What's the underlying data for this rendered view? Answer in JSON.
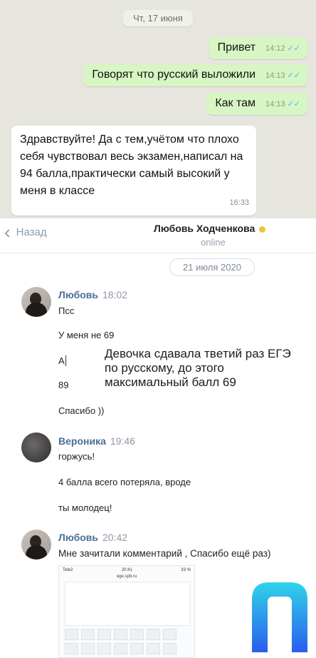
{
  "whatsapp": {
    "date_chip": "Чт, 17 июня",
    "outgoing": [
      {
        "text": "Привет",
        "time": "14:12",
        "ticks": "✓✓"
      },
      {
        "text": "Говорят что русский выложили",
        "time": "14:13",
        "ticks": "✓✓"
      },
      {
        "text": "Как там",
        "time": "14:13",
        "ticks": "✓✓"
      }
    ],
    "incoming": {
      "text": "Здравствуйте! Да с тем,учётом что плохо себя чувствовал весь экзамен,написал на 94 балла,практически самый высокий у меня в классе",
      "time": "16:33"
    }
  },
  "vk": {
    "back_label": "Назад",
    "contact_name": "Любовь Ходченкова",
    "contact_status": "online",
    "date_chip": "21 июля 2020",
    "messages": [
      {
        "sender": "Любовь",
        "time": "18:02",
        "lines": [
          "Псс",
          "У меня не 69",
          "А",
          "89",
          "Спасибо ))"
        ]
      },
      {
        "sender": "Вероника",
        "time": "19:46",
        "lines": [
          "горжусь!",
          "4 балла всего потеряла, вроде",
          "ты молодец!"
        ]
      },
      {
        "sender": "Любовь",
        "time": "20:42",
        "lines": [
          "Мне зачитали комментарий , Спасибо ещё раз)"
        ]
      }
    ],
    "annotation": [
      "Девочка сдавала твeтий раз ЕГЭ",
      "по русскому, до этого",
      "максимальный балл 69"
    ],
    "thumbnail": {
      "carrier": "Tele2",
      "clock": "20:41",
      "battery": "33 %",
      "site": "ege.spb.ru"
    }
  }
}
